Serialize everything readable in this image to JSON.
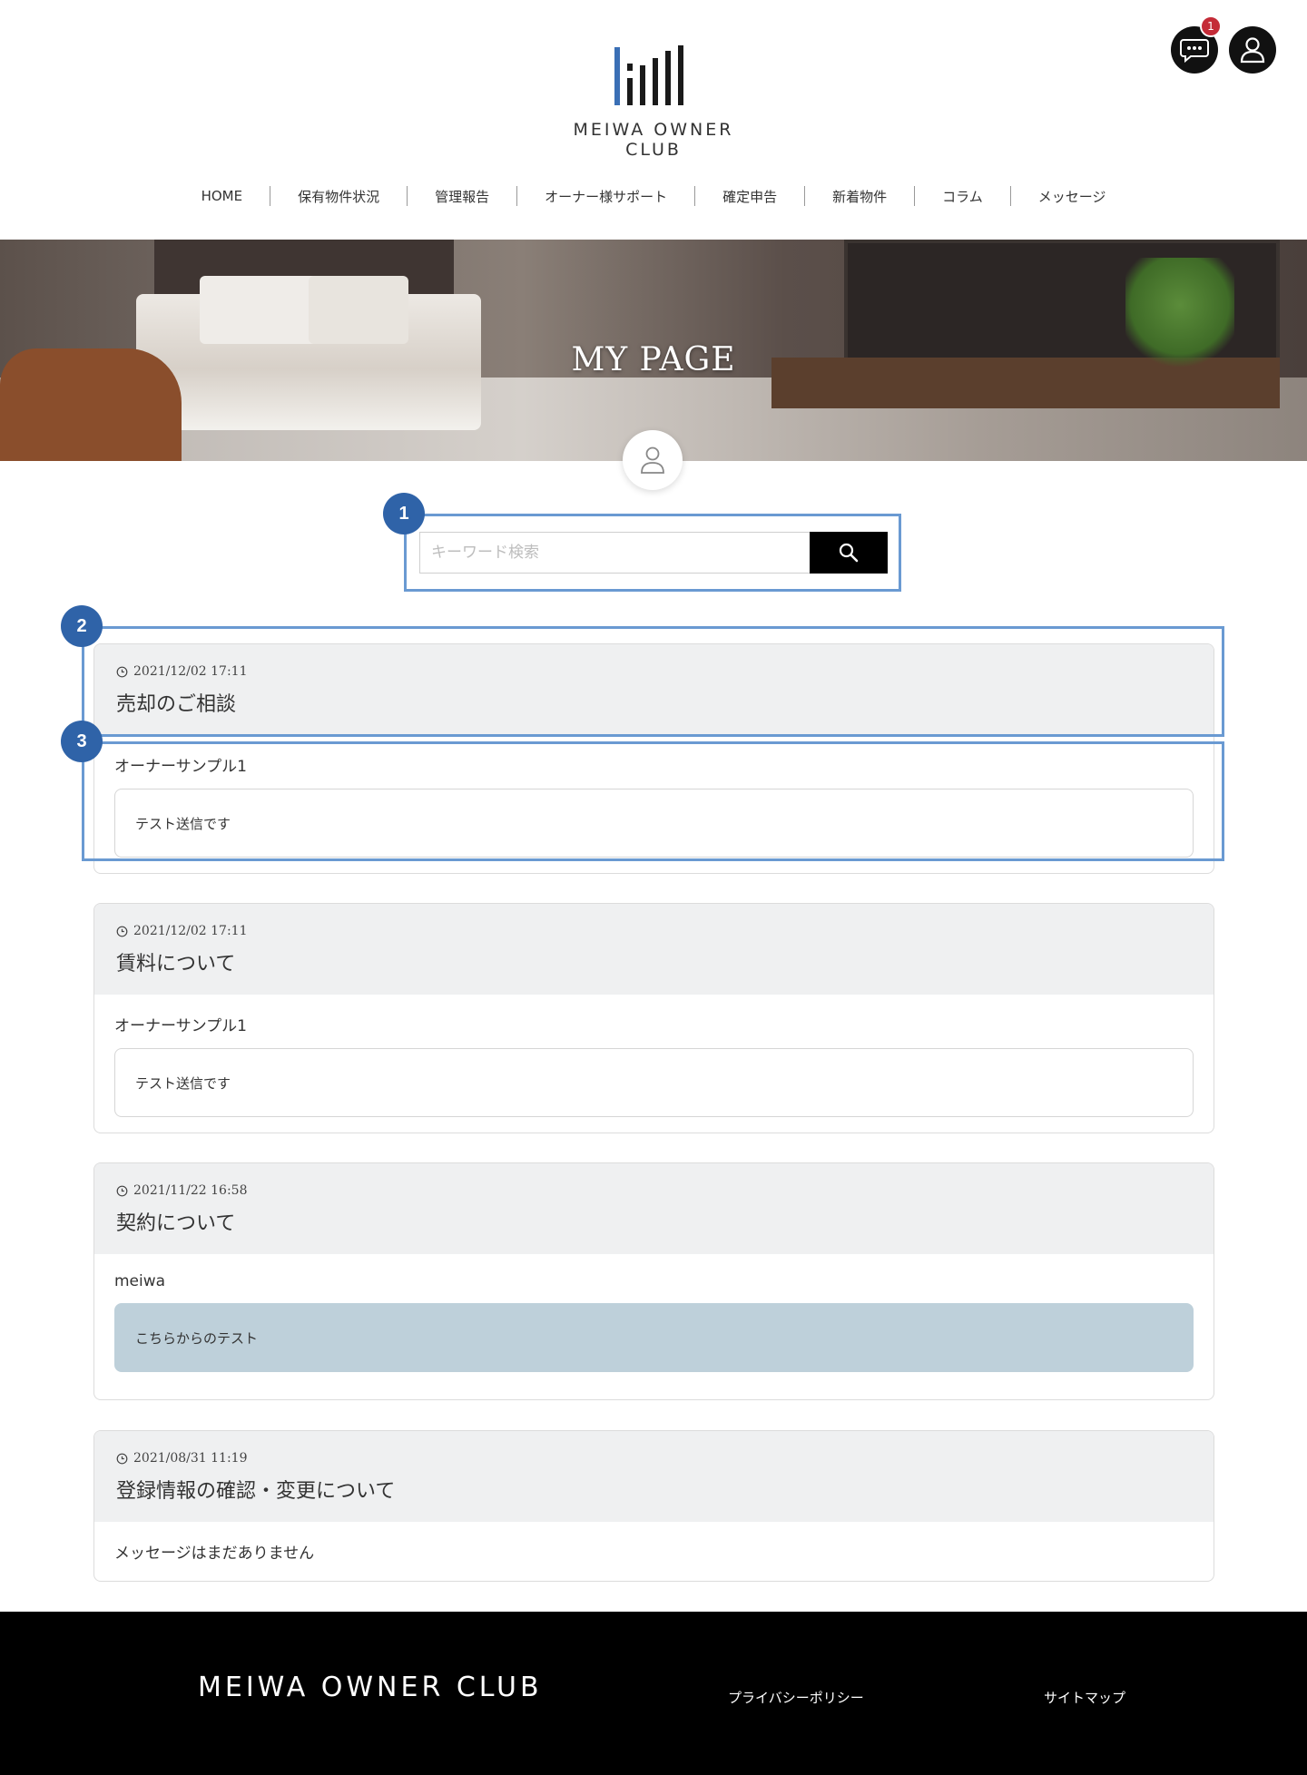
{
  "header": {
    "brand": "MEIWA OWNER CLUB",
    "notification_count": "1"
  },
  "nav": [
    "HOME",
    "保有物件状況",
    "管理報告",
    "オーナー様サポート",
    "確定申告",
    "新着物件",
    "コラム",
    "メッセージ"
  ],
  "hero": {
    "title": "MY PAGE"
  },
  "search": {
    "placeholder": "キーワード検索"
  },
  "annotations": [
    "1",
    "2",
    "3"
  ],
  "threads": [
    {
      "date": "2021/12/02 17:11",
      "title": "売却のご相談",
      "sender": "オーナーサンプル1",
      "message": "テスト送信です"
    },
    {
      "date": "2021/12/02 17:11",
      "title": "賃料について",
      "sender": "オーナーサンプル1",
      "message": "テスト送信です"
    },
    {
      "date": "2021/11/22 16:58",
      "title": "契約について",
      "sender": "meiwa",
      "message": "こちらからのテスト"
    },
    {
      "date": "2021/08/31 11:19",
      "title": "登録情報の確認・変更について",
      "empty": "メッセージはまだありません"
    }
  ],
  "footer": {
    "brand": "MEIWA OWNER CLUB",
    "links": [
      "プライバシーポリシー",
      "サイトマップ"
    ]
  },
  "colors": {
    "accent_blue": "#3a6fb5",
    "annotation_blue": "#2f63a8",
    "badge_red": "#c42b37",
    "card_header_bg": "#eff0f1",
    "reply_bg": "#bed0da"
  },
  "icons": [
    "chat-icon",
    "user-icon",
    "search-icon",
    "clock-icon",
    "avatar-icon"
  ]
}
